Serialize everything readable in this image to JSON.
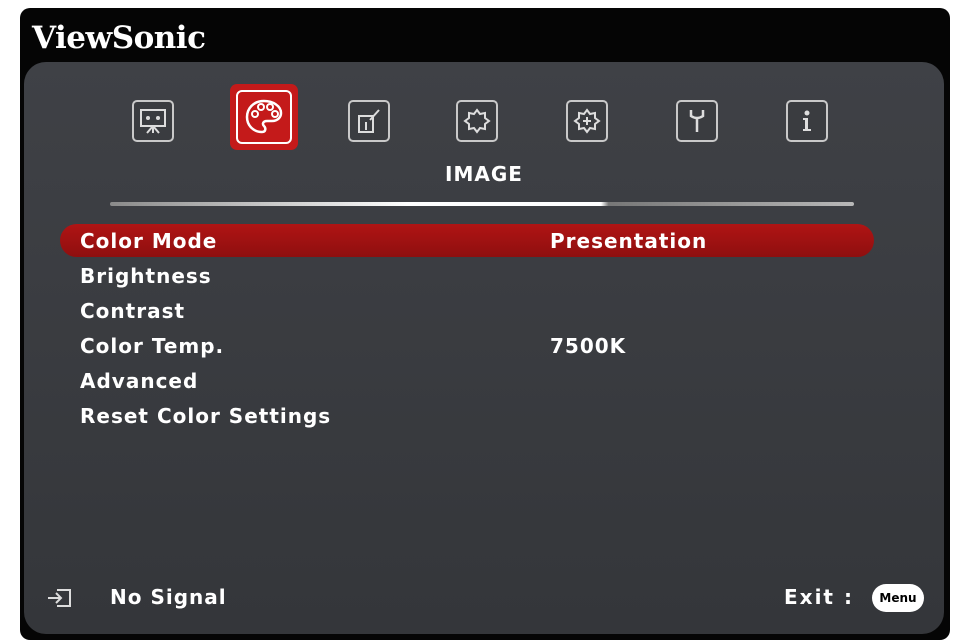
{
  "brand": "ViewSonic",
  "colors": {
    "panel": "#3b3d42",
    "highlight": "#b01414",
    "text": "#ffffff"
  },
  "tabs": [
    {
      "icon": "display-icon",
      "active": false
    },
    {
      "icon": "palette-icon",
      "active": true
    },
    {
      "icon": "source-select-icon",
      "active": false
    },
    {
      "icon": "settings-gear-icon",
      "active": false
    },
    {
      "icon": "advanced-settings-gear-icon",
      "active": false
    },
    {
      "icon": "wrench-icon",
      "active": false
    },
    {
      "icon": "info-icon",
      "active": false
    }
  ],
  "current_tab": "IMAGE",
  "menu": {
    "items": [
      {
        "label": "Color Mode",
        "value": "Presentation",
        "selected": true
      },
      {
        "label": "Brightness",
        "value": ""
      },
      {
        "label": "Contrast",
        "value": ""
      },
      {
        "label": "Color Temp.",
        "value": "7500K"
      },
      {
        "label": "Advanced",
        "value": ""
      },
      {
        "label": "Reset Color Settings",
        "value": ""
      }
    ]
  },
  "footer": {
    "signal_icon": "source-input-icon",
    "signal": "No Signal",
    "exit": "Exit :",
    "menu_badge": "Menu"
  }
}
